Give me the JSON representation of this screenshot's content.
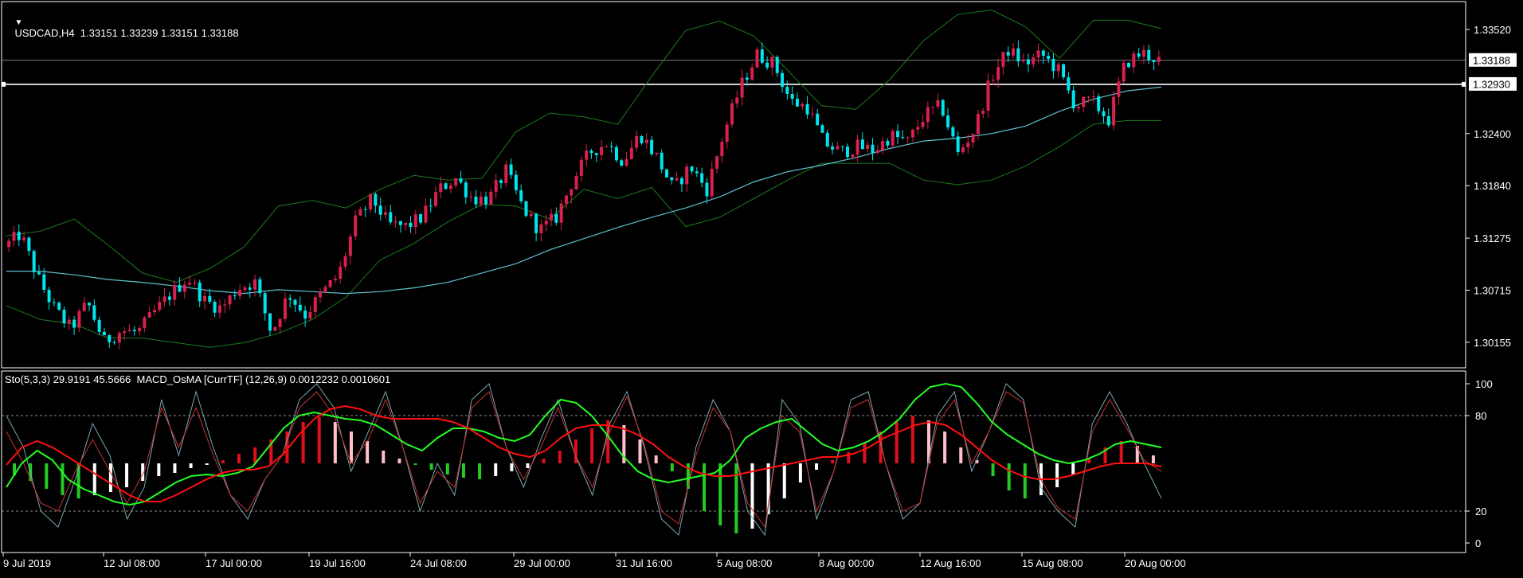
{
  "header": {
    "menu_icon": "triangle-down-icon",
    "symbol_info": "USDCAD,H4  1.33151 1.33239 1.33151 1.33188"
  },
  "indicator_header": "Sto(5,3,3) 29.9191 45.5666  MACD_OsMA [CurrTF] (12,26,9) 0.0012232 0.0010601",
  "colors": {
    "background": "#000000",
    "frame": "#ffffff",
    "bull_candle": "#d9204f",
    "bear_candle": "#00e5ee",
    "bollinger": "#1e7a1e",
    "moving_average": "#5fc0d0",
    "stoch_main": "#7aa7b0",
    "stoch_signal": "#c83232",
    "osma_slow": "#22ff22",
    "osma_fast": "#ff1010",
    "hist_pos_up": "#e0101a",
    "hist_pos_down": "#ffc0cb",
    "hist_neg_down": "#22cc22",
    "hist_neg_up": "#ffffff"
  },
  "price_labels": {
    "current": "1.33188",
    "line": "1.32930"
  },
  "chart_data": [
    {
      "type": "candlestick",
      "symbol": "USDCAD",
      "timeframe": "H4",
      "ylim": [
        1.2988,
        1.3382
      ],
      "yticks": [
        "1.33520",
        "1.32400",
        "1.31840",
        "1.31275",
        "1.30715",
        "1.30155"
      ],
      "xticks": [
        "9 Jul 2019",
        "12 Jul 08:00",
        "17 Jul 00:00",
        "19 Jul 16:00",
        "24 Jul 08:00",
        "29 Jul 00:00",
        "31 Jul 16:00",
        "5 Aug 08:00",
        "8 Aug 00:00",
        "12 Aug 16:00",
        "15 Aug 08:00",
        "20 Aug 00:00"
      ],
      "current_price": 1.33188,
      "horizontal_line": 1.3293,
      "ohlc_waypoints": [
        1.3118,
        1.3132,
        1.3086,
        1.3052,
        1.303,
        1.3058,
        1.3016,
        1.3028,
        1.3026,
        1.3048,
        1.3068,
        1.3085,
        1.306,
        1.3052,
        1.3074,
        1.308,
        1.3025,
        1.3068,
        1.3045,
        1.3068,
        1.3088,
        1.3145,
        1.317,
        1.3142,
        1.314,
        1.315,
        1.318,
        1.3192,
        1.317,
        1.317,
        1.32,
        1.316,
        1.3136,
        1.315,
        1.319,
        1.322,
        1.323,
        1.321,
        1.324,
        1.3215,
        1.318,
        1.3205,
        1.318,
        1.324,
        1.329,
        1.3325,
        1.3315,
        1.3275,
        1.3268,
        1.323,
        1.322,
        1.3226,
        1.3222,
        1.3238,
        1.3231,
        1.326,
        1.327,
        1.3218,
        1.3245,
        1.33,
        1.333,
        1.3315,
        1.3325,
        1.3308,
        1.327,
        1.3275,
        1.3255,
        1.3316,
        1.3327,
        1.3319
      ],
      "moving_average": [
        1.3092,
        1.3092,
        1.3088,
        1.3083,
        1.308,
        1.3076,
        1.3071,
        1.3068,
        1.3072,
        1.307,
        1.3068,
        1.307,
        1.3074,
        1.308,
        1.309,
        1.31,
        1.3115,
        1.3127,
        1.3139,
        1.315,
        1.316,
        1.3172,
        1.3188,
        1.3199,
        1.3206,
        1.3214,
        1.3224,
        1.3232,
        1.3235,
        1.324,
        1.3248,
        1.3264,
        1.3277,
        1.3286,
        1.329
      ],
      "bb_upper": [
        1.313,
        1.3135,
        1.3148,
        1.312,
        1.309,
        1.308,
        1.3095,
        1.3118,
        1.3162,
        1.3168,
        1.316,
        1.318,
        1.3195,
        1.319,
        1.3192,
        1.3242,
        1.3262,
        1.3258,
        1.325,
        1.3302,
        1.3351,
        1.3361,
        1.3345,
        1.3308,
        1.327,
        1.3266,
        1.3298,
        1.334,
        1.3368,
        1.3373,
        1.3355,
        1.3321,
        1.3362,
        1.3362,
        1.3353
      ],
      "bb_lower": [
        1.3055,
        1.304,
        1.3035,
        1.302,
        1.302,
        1.3015,
        1.301,
        1.3015,
        1.3025,
        1.304,
        1.3064,
        1.3104,
        1.3122,
        1.3145,
        1.3164,
        1.3162,
        1.3148,
        1.318,
        1.317,
        1.3182,
        1.314,
        1.315,
        1.317,
        1.319,
        1.3208,
        1.3208,
        1.3208,
        1.319,
        1.3185,
        1.319,
        1.3205,
        1.3226,
        1.325,
        1.3254,
        1.3254
      ]
    },
    {
      "type": "line",
      "title": "Sto(5,3,3)",
      "ylim": [
        0,
        100
      ],
      "yticks": [
        "100",
        "80",
        "20",
        "0"
      ],
      "levels": [
        80,
        20
      ],
      "stoch_main": [
        80,
        60,
        20,
        10,
        40,
        75,
        55,
        15,
        35,
        90,
        55,
        95,
        60,
        30,
        15,
        40,
        55,
        90,
        100,
        85,
        45,
        70,
        95,
        60,
        20,
        50,
        30,
        90,
        100,
        60,
        35,
        65,
        90,
        55,
        30,
        75,
        95,
        60,
        15,
        5,
        60,
        90,
        70,
        20,
        5,
        90,
        75,
        15,
        45,
        90,
        95,
        50,
        15,
        25,
        80,
        95,
        45,
        70,
        100,
        90,
        35,
        20,
        10,
        75,
        95,
        75,
        50,
        28
      ],
      "stoch_signal": [
        70,
        50,
        25,
        20,
        45,
        65,
        45,
        25,
        45,
        85,
        60,
        85,
        55,
        30,
        20,
        40,
        55,
        85,
        95,
        80,
        50,
        65,
        90,
        60,
        25,
        45,
        35,
        85,
        95,
        60,
        40,
        60,
        85,
        55,
        35,
        70,
        92,
        62,
        20,
        12,
        55,
        85,
        70,
        25,
        10,
        80,
        70,
        20,
        45,
        85,
        90,
        50,
        20,
        25,
        75,
        90,
        50,
        70,
        95,
        88,
        40,
        22,
        15,
        70,
        90,
        72,
        52,
        45
      ],
      "osma_slow": [
        35,
        50,
        58,
        52,
        40,
        34,
        30,
        26,
        24,
        26,
        32,
        38,
        42,
        43,
        42,
        44,
        48,
        60,
        72,
        80,
        82,
        80,
        78,
        77,
        74,
        68,
        62,
        58,
        66,
        72,
        72,
        70,
        66,
        64,
        68,
        80,
        90,
        88,
        80,
        68,
        55,
        45,
        40,
        38,
        40,
        42,
        44,
        52,
        66,
        72,
        76,
        78,
        70,
        62,
        58,
        60,
        64,
        70,
        78,
        90,
        98,
        100,
        98,
        88,
        76,
        68,
        62,
        56,
        52,
        50,
        52,
        56,
        62,
        64,
        62,
        60
      ],
      "osma_fast": [
        49,
        60,
        64,
        60,
        54,
        48,
        42,
        36,
        30,
        26,
        26,
        30,
        35,
        40,
        44,
        46,
        46,
        48,
        56,
        68,
        78,
        84,
        86,
        84,
        80,
        78,
        78,
        78,
        78,
        76,
        72,
        66,
        60,
        56,
        54,
        58,
        66,
        72,
        74,
        74,
        72,
        68,
        62,
        54,
        48,
        44,
        42,
        42,
        44,
        46,
        48,
        50,
        52,
        54,
        54,
        56,
        60,
        66,
        70,
        74,
        76,
        74,
        68,
        60,
        52,
        46,
        42,
        40,
        40,
        42,
        45,
        48,
        50,
        50,
        50,
        48
      ],
      "histogram": [
        -15,
        -22,
        -32,
        -40,
        -44,
        -40,
        -36,
        -30,
        -22,
        -16,
        -12,
        -6,
        -2,
        4,
        12,
        20,
        30,
        40,
        52,
        58,
        52,
        40,
        28,
        16,
        6,
        -2,
        -8,
        -14,
        -18,
        -20,
        -16,
        -10,
        -6,
        6,
        16,
        30,
        44,
        54,
        48,
        30,
        10,
        -10,
        -32,
        -60,
        -78,
        -88,
        -82,
        -64,
        -44,
        -24,
        -8,
        4,
        14,
        26,
        40,
        52,
        60,
        54,
        40,
        20,
        4,
        -16,
        -34,
        -44,
        -40,
        -30,
        -14,
        6,
        20,
        28,
        22,
        10
      ]
    }
  ]
}
